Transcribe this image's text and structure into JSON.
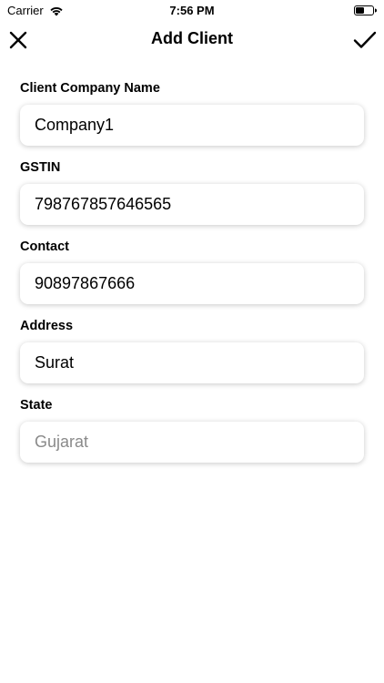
{
  "status_bar": {
    "carrier": "Carrier",
    "time": "7:56 PM"
  },
  "nav": {
    "title": "Add Client",
    "close_icon": "close-icon",
    "save_icon": "checkmark-icon"
  },
  "form": {
    "fields": [
      {
        "label": "Client Company Name",
        "value": "Company1",
        "placeholder": ""
      },
      {
        "label": "GSTIN",
        "value": "798767857646565",
        "placeholder": ""
      },
      {
        "label": "Contact",
        "value": "90897867666",
        "placeholder": ""
      },
      {
        "label": "Address",
        "value": "Surat",
        "placeholder": ""
      },
      {
        "label": "State",
        "value": "",
        "placeholder": "Gujarat"
      }
    ]
  }
}
